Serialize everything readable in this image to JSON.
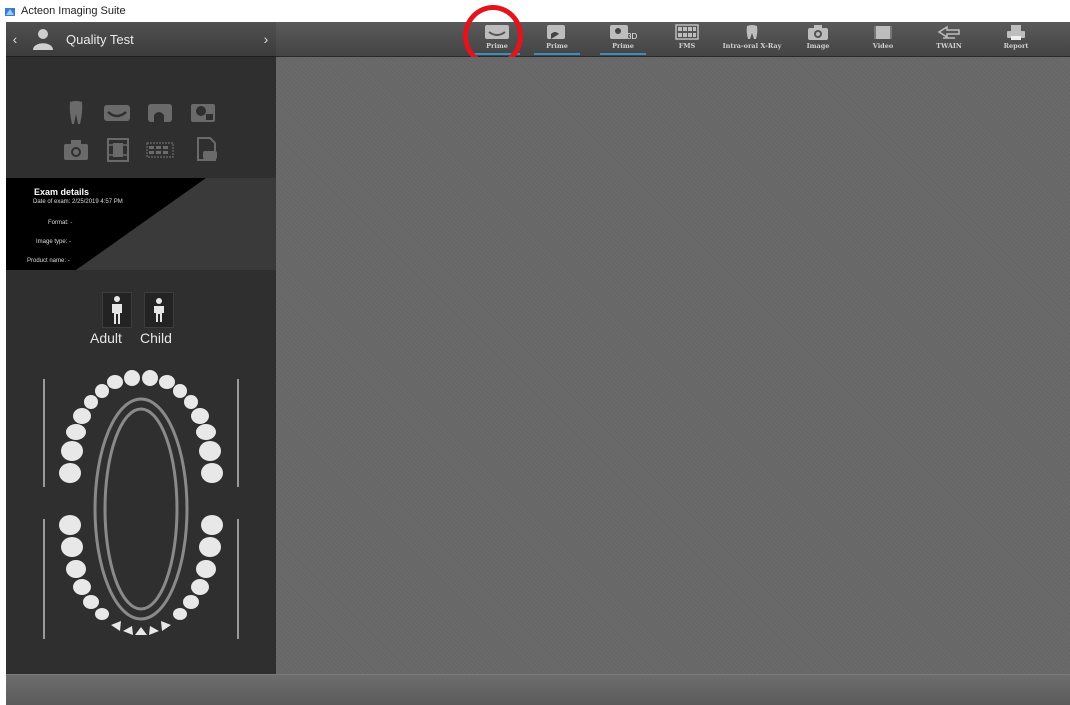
{
  "window": {
    "title": "Acteon Imaging Suite",
    "icon": "app-logo-icon"
  },
  "patient": {
    "name": "Quality Test",
    "prev_icon": "chevron-left-icon",
    "next_icon": "chevron-right-icon",
    "avatar_icon": "person-icon"
  },
  "toolbar": {
    "items": [
      {
        "label": "Prime",
        "icon": "intraoral-sensor-icon",
        "highlighted": true
      },
      {
        "label": "Prime",
        "icon": "panoramic-icon"
      },
      {
        "label": "Prime",
        "icon": "3d-panoramic-icon",
        "badge": "3D"
      },
      {
        "label": "FMS",
        "icon": "fms-icon"
      },
      {
        "label": "Intra-oral X-Ray",
        "icon": "tooth-icon"
      },
      {
        "label": "Image",
        "icon": "camera-icon"
      },
      {
        "label": "Video",
        "icon": "video-icon"
      },
      {
        "label": "TWAIN",
        "icon": "twain-icon"
      },
      {
        "label": "Report",
        "icon": "printer-icon"
      }
    ]
  },
  "acquisition_icons": [
    "tooth-icon",
    "sensor-icon",
    "panoramic-icon",
    "cephalometric-icon",
    "camera-icon",
    "film-icon",
    "fms-icon",
    "document-icon"
  ],
  "exam_details": {
    "title": "Exam details",
    "date_label": "Date of exam:",
    "date_value": "2/25/2019 4:57 PM",
    "format_label": "Format:",
    "format_value": "-",
    "image_type_label": "Image type:",
    "image_type_value": "-",
    "product_name_label": "Product name:",
    "product_name_value": "-"
  },
  "dentition": {
    "adult_label": "Adult",
    "child_label": "Child"
  },
  "colors": {
    "highlight_ring": "#e3141b",
    "toolbar_underline": "#3a8fbf",
    "sidebar_bg": "#2f2f2f",
    "workspace_bg": "#6a6a6a"
  }
}
